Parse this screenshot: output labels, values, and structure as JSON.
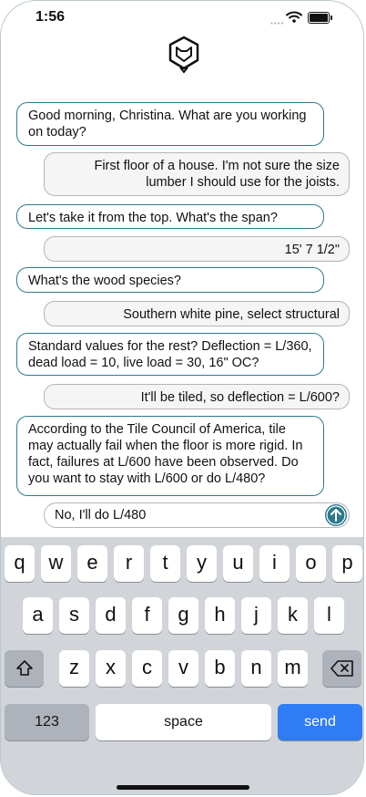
{
  "status": {
    "time": "1:56"
  },
  "messages": [
    {
      "role": "bot",
      "text": "Good morning, Christina. What are you working on today?"
    },
    {
      "role": "user",
      "text": "First floor of a house. I'm not sure the size lumber I should use for the joists."
    },
    {
      "role": "bot",
      "text": "Let's take it from the top. What's the span?"
    },
    {
      "role": "user",
      "text": "15' 7 1/2\""
    },
    {
      "role": "bot",
      "text": "What's the wood species?"
    },
    {
      "role": "user",
      "text": "Southern white pine, select structural"
    },
    {
      "role": "bot",
      "text": "Standard values for the rest? Deflection = L/360, dead load = 10, live load = 30, 16\" OC?"
    },
    {
      "role": "user",
      "text": "It'll be tiled, so deflection = L/600?"
    },
    {
      "role": "bot",
      "text": "According to the Tile Council of America, tile may actually fail when the floor is more rigid. In fact, failures at L/600 have been observed. Do you want to stay with L/600 or do L/480?"
    }
  ],
  "composer": {
    "value": "No, I'll do L/480"
  },
  "keyboard": {
    "row1": [
      "q",
      "w",
      "e",
      "r",
      "t",
      "y",
      "u",
      "i",
      "o",
      "p"
    ],
    "row2": [
      "a",
      "s",
      "d",
      "f",
      "g",
      "h",
      "j",
      "k",
      "l"
    ],
    "row3": [
      "z",
      "x",
      "c",
      "v",
      "b",
      "n",
      "m"
    ],
    "numbers_label": "123",
    "space_label": "space",
    "send_label": "send"
  },
  "colors": {
    "accent": "#2d7a8e",
    "send_key": "#2f7cf6",
    "keyboard_bg": "#d1d4d9"
  }
}
